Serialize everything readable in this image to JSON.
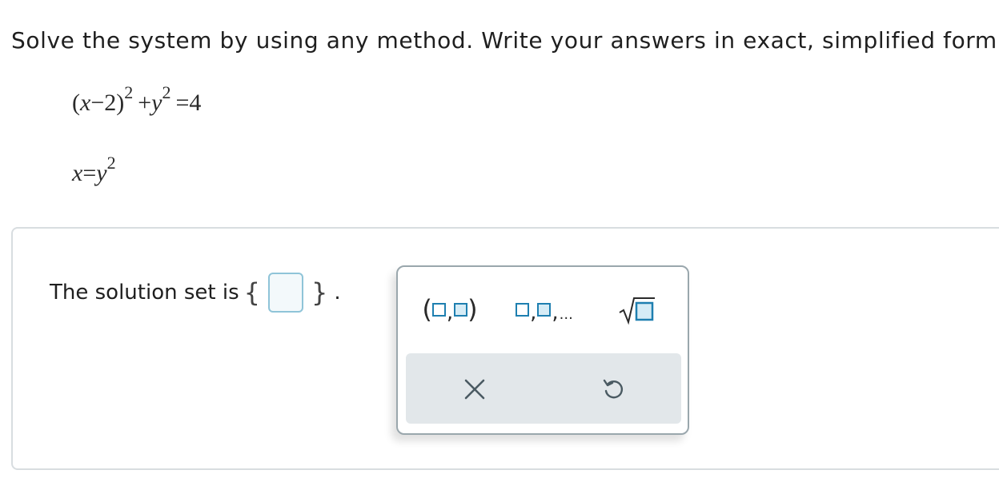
{
  "instruction": "Solve the system by using any method. Write your answers in exact, simplified form.",
  "equations": {
    "eq1": {
      "open": "(",
      "x": "x",
      "minus": "−",
      "two": "2",
      "close": ")",
      "exp1": "2",
      "plus": "+",
      "y": "y",
      "exp2": "2",
      "equals": "=",
      "rhs": "4"
    },
    "eq2": {
      "x": "x",
      "equals": "=",
      "y": "y",
      "exp": "2"
    }
  },
  "answer": {
    "label": "The solution set is",
    "open_brace": "{",
    "close_brace": "}",
    "period": ".",
    "value": ""
  },
  "palette": {
    "tools": [
      {
        "name": "ordered-pair",
        "icon": "ordered-pair-icon"
      },
      {
        "name": "list",
        "icon": "list-icon",
        "ellipsis": "..."
      },
      {
        "name": "square-root",
        "icon": "sqrt-icon"
      }
    ],
    "actions": [
      {
        "name": "clear",
        "icon": "close-icon"
      },
      {
        "name": "undo",
        "icon": "undo-icon"
      }
    ],
    "colors": {
      "accent": "#1e7fb0",
      "action_bar": "#e2e7ea",
      "icon": "#4a5a62"
    }
  }
}
